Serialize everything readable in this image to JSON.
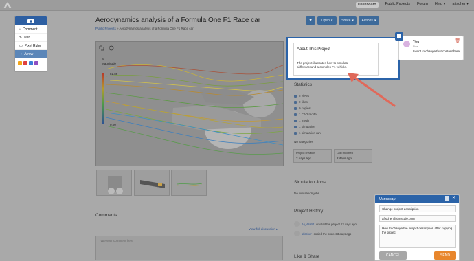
{
  "topnav": {
    "items": [
      {
        "label": "Dashboard",
        "active": true
      },
      {
        "label": "Public Projects",
        "active": false
      },
      {
        "label": "Forum",
        "active": false
      },
      {
        "label": "Help ▾",
        "active": false
      },
      {
        "label": "afischer ▾",
        "active": false
      }
    ]
  },
  "page": {
    "title": "Aerodynamics analysis of a Formula One F1 Race car",
    "breadcrumb_link": "Public Projects",
    "breadcrumb_rest": " » Aerodynamics analysis of a Formula One F1 Race car"
  },
  "actions": {
    "like_icon": "heart-icon",
    "open_label": "Open",
    "share_label": "Share",
    "actions_label": "Actions"
  },
  "viewer": {
    "unit": "SI",
    "scalar": "Magnitude",
    "max_value": "81.86",
    "min_value": "0.00"
  },
  "about": {
    "title": "About This Project",
    "description": "The project illustrates how to simulate airflow around a complex F1 vehicle."
  },
  "annotation": {
    "author": "You",
    "time": "Now",
    "text": "I want to change that content here"
  },
  "statistics": {
    "title": "Statistics",
    "rows": [
      "5 views",
      "0 likes",
      "0 copies",
      "1 CAD model",
      "1 mesh",
      "1 simulation",
      "1 simulation run"
    ],
    "no_categories": "No categories",
    "creation_label": "Project creation",
    "creation_value": "2 days ago",
    "modified_label": "Last modified",
    "modified_value": "2 days ago"
  },
  "simulation_jobs": {
    "title": "Simulation Jobs",
    "empty": "No simulation jobs"
  },
  "history": {
    "title": "Project History",
    "entries": [
      {
        "user": "Ali_Arafat",
        "text": " created the project 13 days ago"
      },
      {
        "user": "afischer",
        "text": " copied the project 3 days ago"
      }
    ]
  },
  "like_share": {
    "title": "Like & Share"
  },
  "comments": {
    "title": "Comments",
    "view_full": "View full discussion ▸",
    "placeholder": "Type your comment here"
  },
  "toolbox": {
    "items": [
      "Comment",
      "Pen",
      "Pixel Ruler",
      "Arrow"
    ],
    "active": "Arrow",
    "swatches": [
      "#f2a51a",
      "#e04040",
      "#3b7dd8",
      "#8e4fc2"
    ]
  },
  "usersnap": {
    "title": "Usersnap",
    "subject": "Change project description",
    "email": "afischer@simscale.com",
    "message": "How to change the project description after copying the project",
    "cancel": "CANCEL",
    "send": "SEND"
  },
  "colors": {
    "primary": "#2b63a8",
    "send": "#e8862c",
    "cancel": "#a7a7a7",
    "arrow": "#e0695a"
  }
}
